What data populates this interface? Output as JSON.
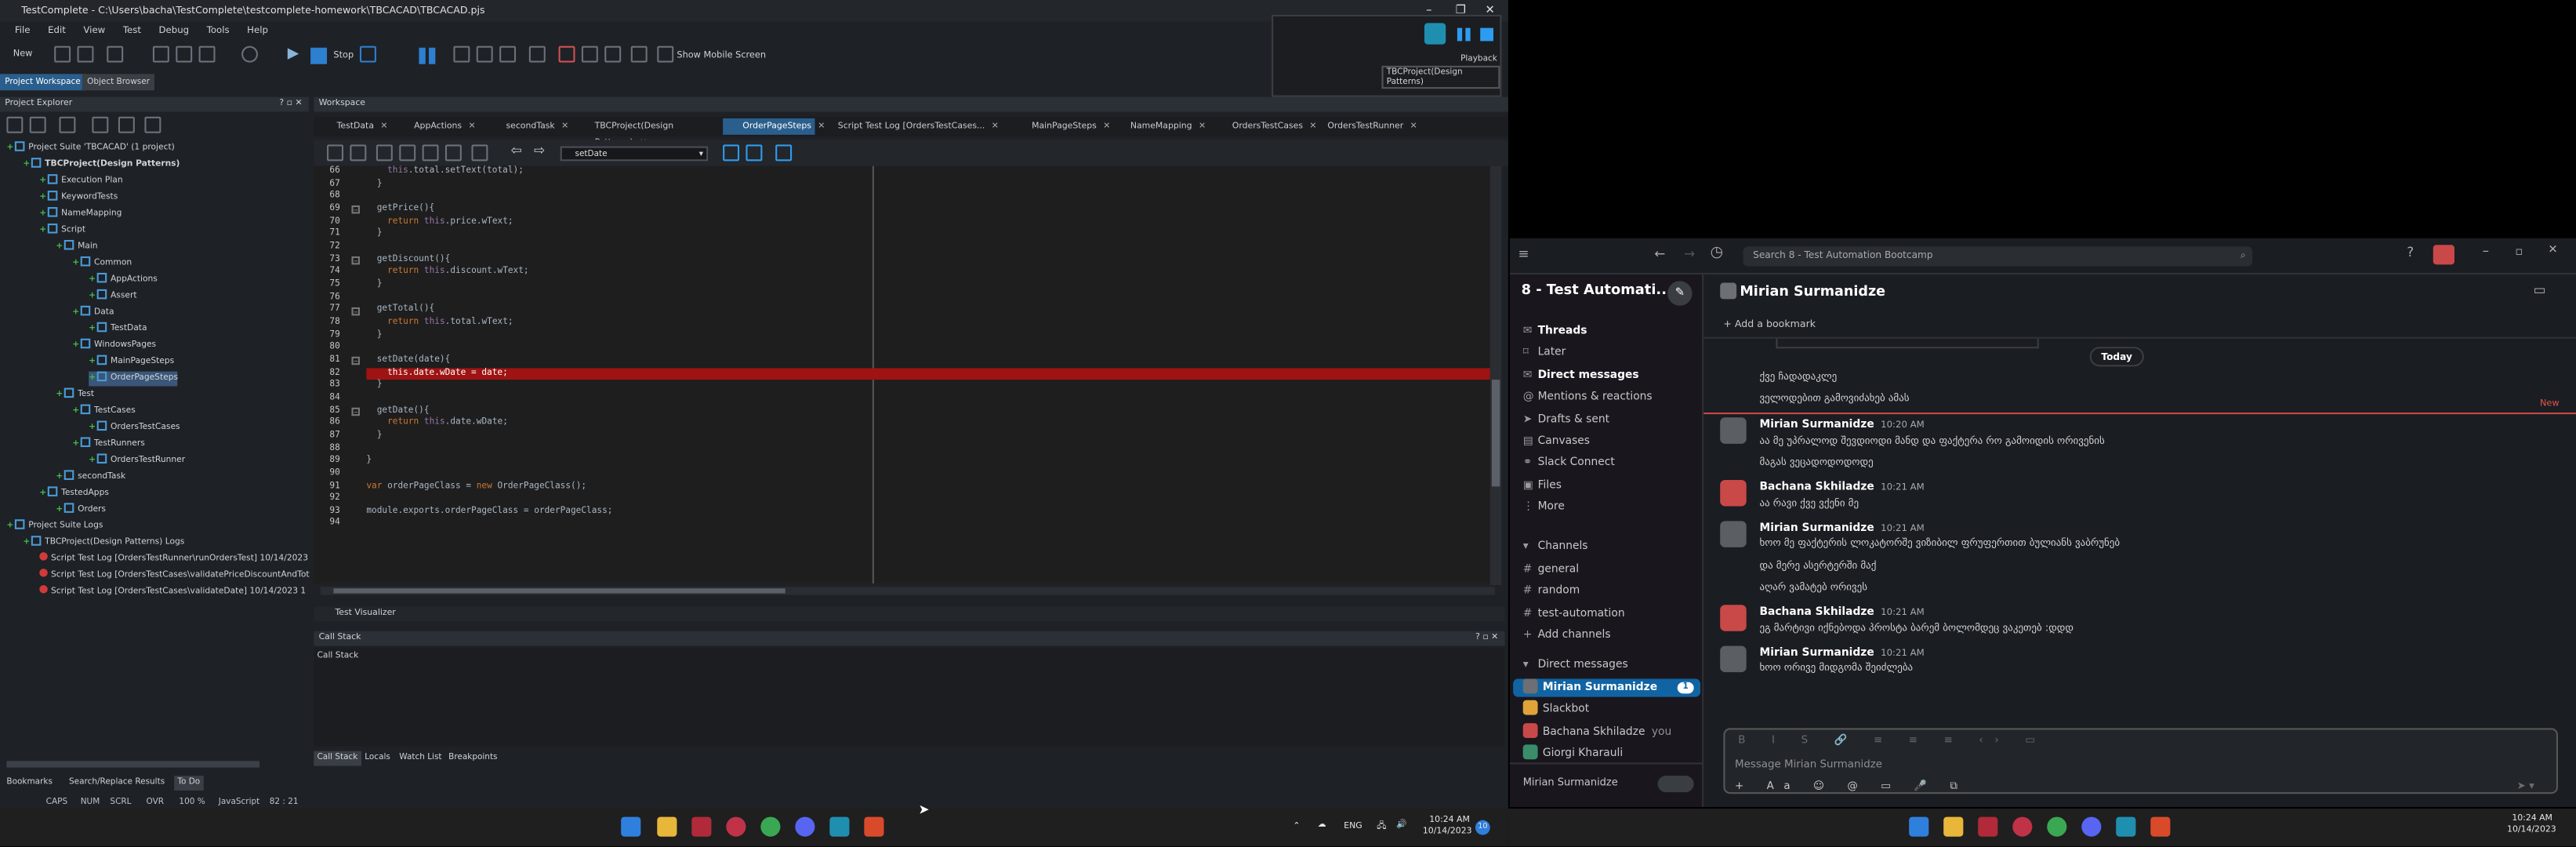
{
  "tc": {
    "title": "TestComplete - C:\\Users\\bacha\\TestComplete\\testcomplete-homework\\TBCACAD\\TBCACAD.pjs",
    "menu": [
      "File",
      "Edit",
      "View",
      "Test",
      "Debug",
      "Tools",
      "Help"
    ],
    "toolbar": {
      "new_label": "New",
      "stop_label": "Stop",
      "mobile_label": "Show Mobile Screen"
    },
    "doc_tabs": [
      "Project Workspace",
      "Object Browser"
    ],
    "playback_label": "Playback",
    "playback_project": "TBCProject(Design Patterns)",
    "project_explorer_title": "Project Explorer",
    "workspace_title": "Workspace",
    "tree": [
      {
        "label": "Project Suite 'TBCACAD' (1 project)",
        "depth": 0
      },
      {
        "label": "TBCProject(Design Patterns)",
        "depth": 1,
        "bold": true
      },
      {
        "label": "Execution Plan",
        "depth": 2
      },
      {
        "label": "KeywordTests",
        "depth": 2
      },
      {
        "label": "NameMapping",
        "depth": 2
      },
      {
        "label": "Script",
        "depth": 2
      },
      {
        "label": "Main",
        "depth": 3
      },
      {
        "label": "Common",
        "depth": 4
      },
      {
        "label": "AppActions",
        "depth": 5
      },
      {
        "label": "Assert",
        "depth": 5
      },
      {
        "label": "Data",
        "depth": 4
      },
      {
        "label": "TestData",
        "depth": 5
      },
      {
        "label": "WindowsPages",
        "depth": 4
      },
      {
        "label": "MainPageSteps",
        "depth": 5
      },
      {
        "label": "OrderPageSteps",
        "depth": 5,
        "selected": true
      },
      {
        "label": "Test",
        "depth": 3
      },
      {
        "label": "TestCases",
        "depth": 4
      },
      {
        "label": "OrdersTestCases",
        "depth": 5
      },
      {
        "label": "TestRunners",
        "depth": 4
      },
      {
        "label": "OrdersTestRunner",
        "depth": 5
      },
      {
        "label": "secondTask",
        "depth": 3
      },
      {
        "label": "TestedApps",
        "depth": 2
      },
      {
        "label": "Orders",
        "depth": 3
      },
      {
        "label": "Project Suite Logs",
        "depth": 0
      },
      {
        "label": "TBCProject(Design Patterns) Logs",
        "depth": 1
      },
      {
        "label": "Script Test Log [OrdersTestRunner\\runOrdersTest] 10/14/2023",
        "depth": 2,
        "log": true
      },
      {
        "label": "Script Test Log [OrdersTestCases\\validatePriceDiscountAndTot",
        "depth": 2,
        "log": true
      },
      {
        "label": "Script Test Log [OrdersTestCases\\validateDate] 10/14/2023 1",
        "depth": 2,
        "log": true
      }
    ],
    "ws_tabs": [
      {
        "label": "TestData"
      },
      {
        "label": "AppActions"
      },
      {
        "label": "secondTask"
      },
      {
        "label": "TBCProject(Design Patterns)"
      },
      {
        "label": "OrderPageSteps",
        "active": true
      },
      {
        "label": "Script Test Log [OrdersTestCases..."
      },
      {
        "label": "MainPageSteps"
      },
      {
        "label": "NameMapping"
      },
      {
        "label": "OrdersTestCases"
      },
      {
        "label": "OrdersTestRunner"
      }
    ],
    "func_combo": "setDate",
    "code": [
      {
        "n": "66",
        "t": "    this.total.setText(total);"
      },
      {
        "n": "67",
        "t": "  }"
      },
      {
        "n": "68",
        "t": ""
      },
      {
        "n": "69",
        "t": "  getPrice(){"
      },
      {
        "n": "70",
        "t": "    return this.price.wText;"
      },
      {
        "n": "71",
        "t": "  }"
      },
      {
        "n": "72",
        "t": ""
      },
      {
        "n": "73",
        "t": "  getDiscount(){"
      },
      {
        "n": "74",
        "t": "    return this.discount.wText;"
      },
      {
        "n": "75",
        "t": "  }"
      },
      {
        "n": "76",
        "t": ""
      },
      {
        "n": "77",
        "t": "  getTotal(){"
      },
      {
        "n": "78",
        "t": "    return this.total.wText;"
      },
      {
        "n": "79",
        "t": "  }"
      },
      {
        "n": "80",
        "t": ""
      },
      {
        "n": "81",
        "t": "  setDate(date){"
      },
      {
        "n": "82",
        "t": "    this.date.wDate = date;",
        "bp": true
      },
      {
        "n": "83",
        "t": "  }"
      },
      {
        "n": "84",
        "t": ""
      },
      {
        "n": "85",
        "t": "  getDate(){"
      },
      {
        "n": "86",
        "t": "    return this.date.wDate;"
      },
      {
        "n": "87",
        "t": "  }"
      },
      {
        "n": "88",
        "t": ""
      },
      {
        "n": "89",
        "t": "}"
      },
      {
        "n": "90",
        "t": ""
      },
      {
        "n": "91",
        "t": "var orderPageClass = new OrderPageClass();"
      },
      {
        "n": "92",
        "t": ""
      },
      {
        "n": "93",
        "t": "module.exports.orderPageClass = orderPageClass;"
      },
      {
        "n": "94",
        "t": ""
      }
    ],
    "test_visualizer": "Test Visualizer",
    "callstack_title": "Call Stack",
    "callstack_col": "Call Stack",
    "bottom_tabs": [
      "Call Stack",
      "Locals",
      "Watch List",
      "Breakpoints"
    ],
    "left_bottom_tabs": [
      "Bookmarks",
      "Search/Replace Results",
      "To Do"
    ],
    "status": [
      "CAPS",
      "NUM",
      "SCRL",
      "OVR",
      "100 %",
      "JavaScript",
      "82 : 21"
    ]
  },
  "slack": {
    "search_placeholder": "Search 8 - Test Automation Bootcamp",
    "workspace": "8 - Test Automati...",
    "nav": [
      "Threads",
      "Later",
      "Direct messages",
      "Mentions & reactions",
      "Drafts & sent",
      "Canvases",
      "Slack Connect",
      "Files",
      "More"
    ],
    "channels_header": "Channels",
    "channels": [
      "general",
      "random",
      "test-automation"
    ],
    "add_channels": "Add channels",
    "dm_header": "Direct messages",
    "dms": [
      {
        "name": "Mirian Surmanidze",
        "badge": "1",
        "selected": true
      },
      {
        "name": "Slackbot"
      },
      {
        "name": "Bachana Skhiladze",
        "suffix": "you"
      },
      {
        "name": "Giorgi Kharauli"
      }
    ],
    "footer_name": "Mirian Surmanidze",
    "chat_title": "Mirian Surmanidze",
    "add_bookmark": "Add a bookmark",
    "today": "Today",
    "new_label": "New",
    "pre_messages": [
      "ქვე ჩადადაკლე",
      "ველოდებით გამოვიძახებ ამას"
    ],
    "messages": [
      {
        "name": "Mirian Surmanidze",
        "time": "10:20 AM",
        "lines": [
          "აა მე უპრალოდ შევდიოდი მანდ და ფაქტერა რო გამოიდის ორივენის",
          "მაგას ვეცადოდოდოდე"
        ]
      },
      {
        "name": "Bachana Skhiladze",
        "time": "10:21 AM",
        "lines": [
          "აა რავი ქვე ვქენი მე"
        ]
      },
      {
        "name": "Mirian Surmanidze",
        "time": "10:21 AM",
        "lines": [
          "ხოო მე ფაქტერის ლოკატორშე ვიზიბილ ფრუფერთით ბულიანს ვაბრუნებ",
          "და მერე ასერტერში მაქ",
          "აღარ ვამატებ ორივეს"
        ]
      },
      {
        "name": "Bachana Skhiladze",
        "time": "10:21 AM",
        "lines": [
          "ეგ მარტივი იქნებოდა პროსტა ბარემ ბოლომდეც ვაკეთებ :დდდ"
        ]
      },
      {
        "name": "Mirian Surmanidze",
        "time": "10:21 AM",
        "lines": [
          "ხოო ორივე მიდგომა შეიძლება"
        ]
      }
    ],
    "composer_placeholder": "Message Mirian Surmanidze"
  },
  "taskbar": {
    "left_tray": {
      "lang": "ENG",
      "time": "10:24 AM",
      "date": "10/14/2023",
      "count": "10"
    },
    "right_tray": {
      "time": "10:24 AM",
      "date": "10/14/2023"
    }
  }
}
